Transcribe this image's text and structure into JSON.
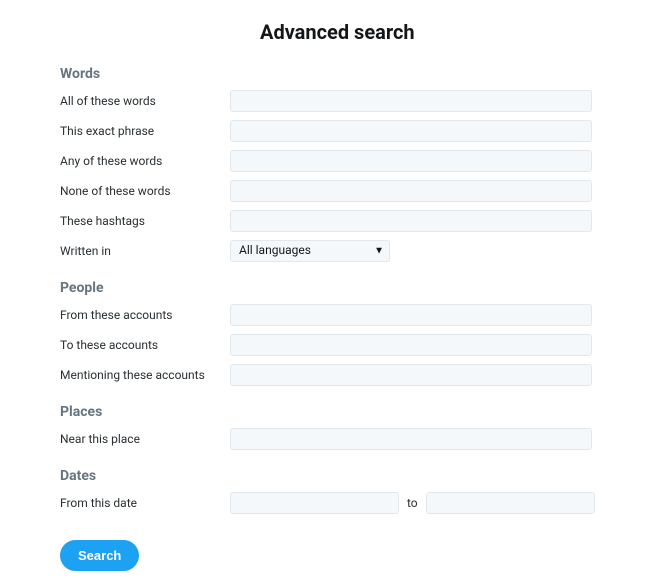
{
  "title": "Advanced search",
  "sections": {
    "words": {
      "heading": "Words",
      "all_label": "All of these words",
      "exact_label": "This exact phrase",
      "any_label": "Any of these words",
      "none_label": "None of these words",
      "hashtags_label": "These hashtags",
      "written_label": "Written in",
      "language_selected": "All languages"
    },
    "people": {
      "heading": "People",
      "from_label": "From these accounts",
      "to_label": "To these accounts",
      "mentioning_label": "Mentioning these accounts"
    },
    "places": {
      "heading": "Places",
      "near_label": "Near this place"
    },
    "dates": {
      "heading": "Dates",
      "from_label": "From this date",
      "to_text": "to"
    }
  },
  "search_button": "Search"
}
